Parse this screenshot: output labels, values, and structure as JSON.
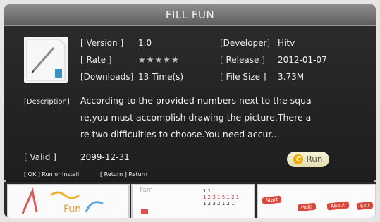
{
  "dialog": {
    "title": "FILL FUN",
    "fields": {
      "version_label": "[ Version ]",
      "version_value": "1.0",
      "developer_label": "[Developer]",
      "developer_value": "Hitv",
      "rate_label": "[ Rate ]",
      "rate_value": "★★★★★",
      "release_label": "[ Release ]",
      "release_value": "2012-01-07",
      "downloads_label": "[Downloads]",
      "downloads_value": "13 Time(s)",
      "filesize_label": "[ File Size ]",
      "filesize_value": "3.73M",
      "valid_label": "[ Valid ]",
      "valid_value": "2099-12-31"
    },
    "description": {
      "label": "[Description]",
      "lines": [
        "According to the provided numbers next to the squa",
        "re,you must accomplish drawing the picture.There a",
        "re two difficulties to choose.You need accur..."
      ]
    },
    "run_label": "Run",
    "hints": {
      "ok": "[ OK ] Run or Install",
      "return": "[ Return ] Return"
    },
    "icons": {
      "app": "pencil-document-icon",
      "run": "c-run-icon"
    }
  },
  "screenshots": {
    "thumb1_text": "Fun",
    "thumb2_text": "Fam",
    "thumb2_numbers": [
      "1 1",
      "1 2 3 1 5 1 2 1",
      "1 2 3 2 1 2 1"
    ],
    "thumb3_buttons": [
      "Start",
      "Help",
      "About",
      "Exit"
    ]
  },
  "colors": {
    "dialog_bg": "#262626",
    "title_bar": "#757575",
    "run_button": "#ece5c0",
    "run_accent": "#f2a900"
  }
}
